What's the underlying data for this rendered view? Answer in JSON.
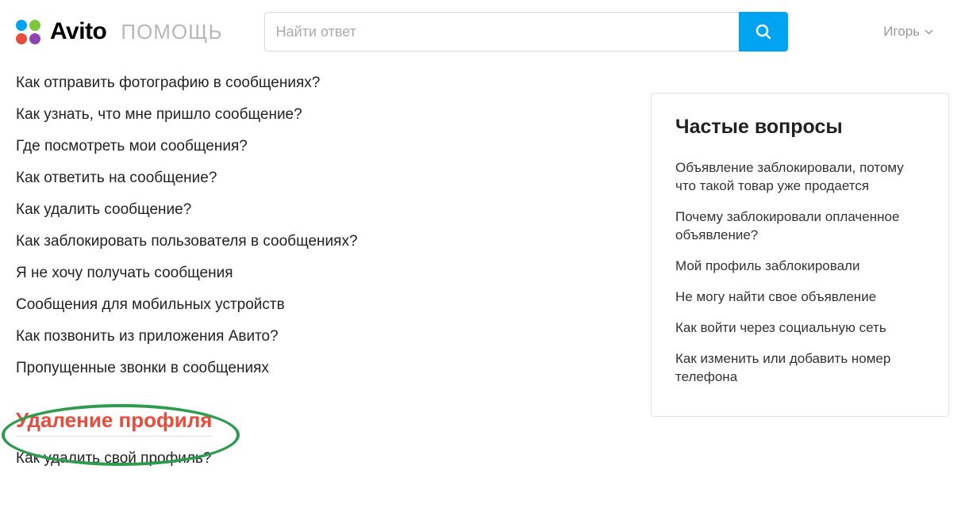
{
  "header": {
    "brand": "Avito",
    "brandSub": "помощь",
    "searchPlaceholder": "Найти ответ",
    "userName": "Игорь"
  },
  "faq_items": [
    "Как отправить фотографию в сообщениях?",
    "Как узнать, что мне пришло сообщение?",
    "Где посмотреть мои сообщения?",
    "Как ответить на сообщение?",
    "Как удалить сообщение?",
    "Как заблокировать пользователя в сообщениях?",
    "Я не хочу получать сообщения",
    "Сообщения для мобильных устройств",
    "Как позвонить из приложения Авито?",
    "Пропущенные звонки в сообщениях"
  ],
  "section_title": "Удаление профиля",
  "section_items": [
    "Как удалить свой профиль?"
  ],
  "sidebar": {
    "title": "Частые вопросы",
    "items": [
      "Объявление заблокировали, потому что такой товар уже продается",
      "Почему заблокировали оплаченное объявление?",
      "Мой профиль заблокировали",
      "Не могу найти свое объявление",
      "Как войти через социальную сеть",
      "Как изменить или добавить номер телефона"
    ]
  },
  "colors": {
    "accent": "#00a3f0",
    "highlight_text": "#e74c3c",
    "annotation": "#2e9b4f"
  }
}
